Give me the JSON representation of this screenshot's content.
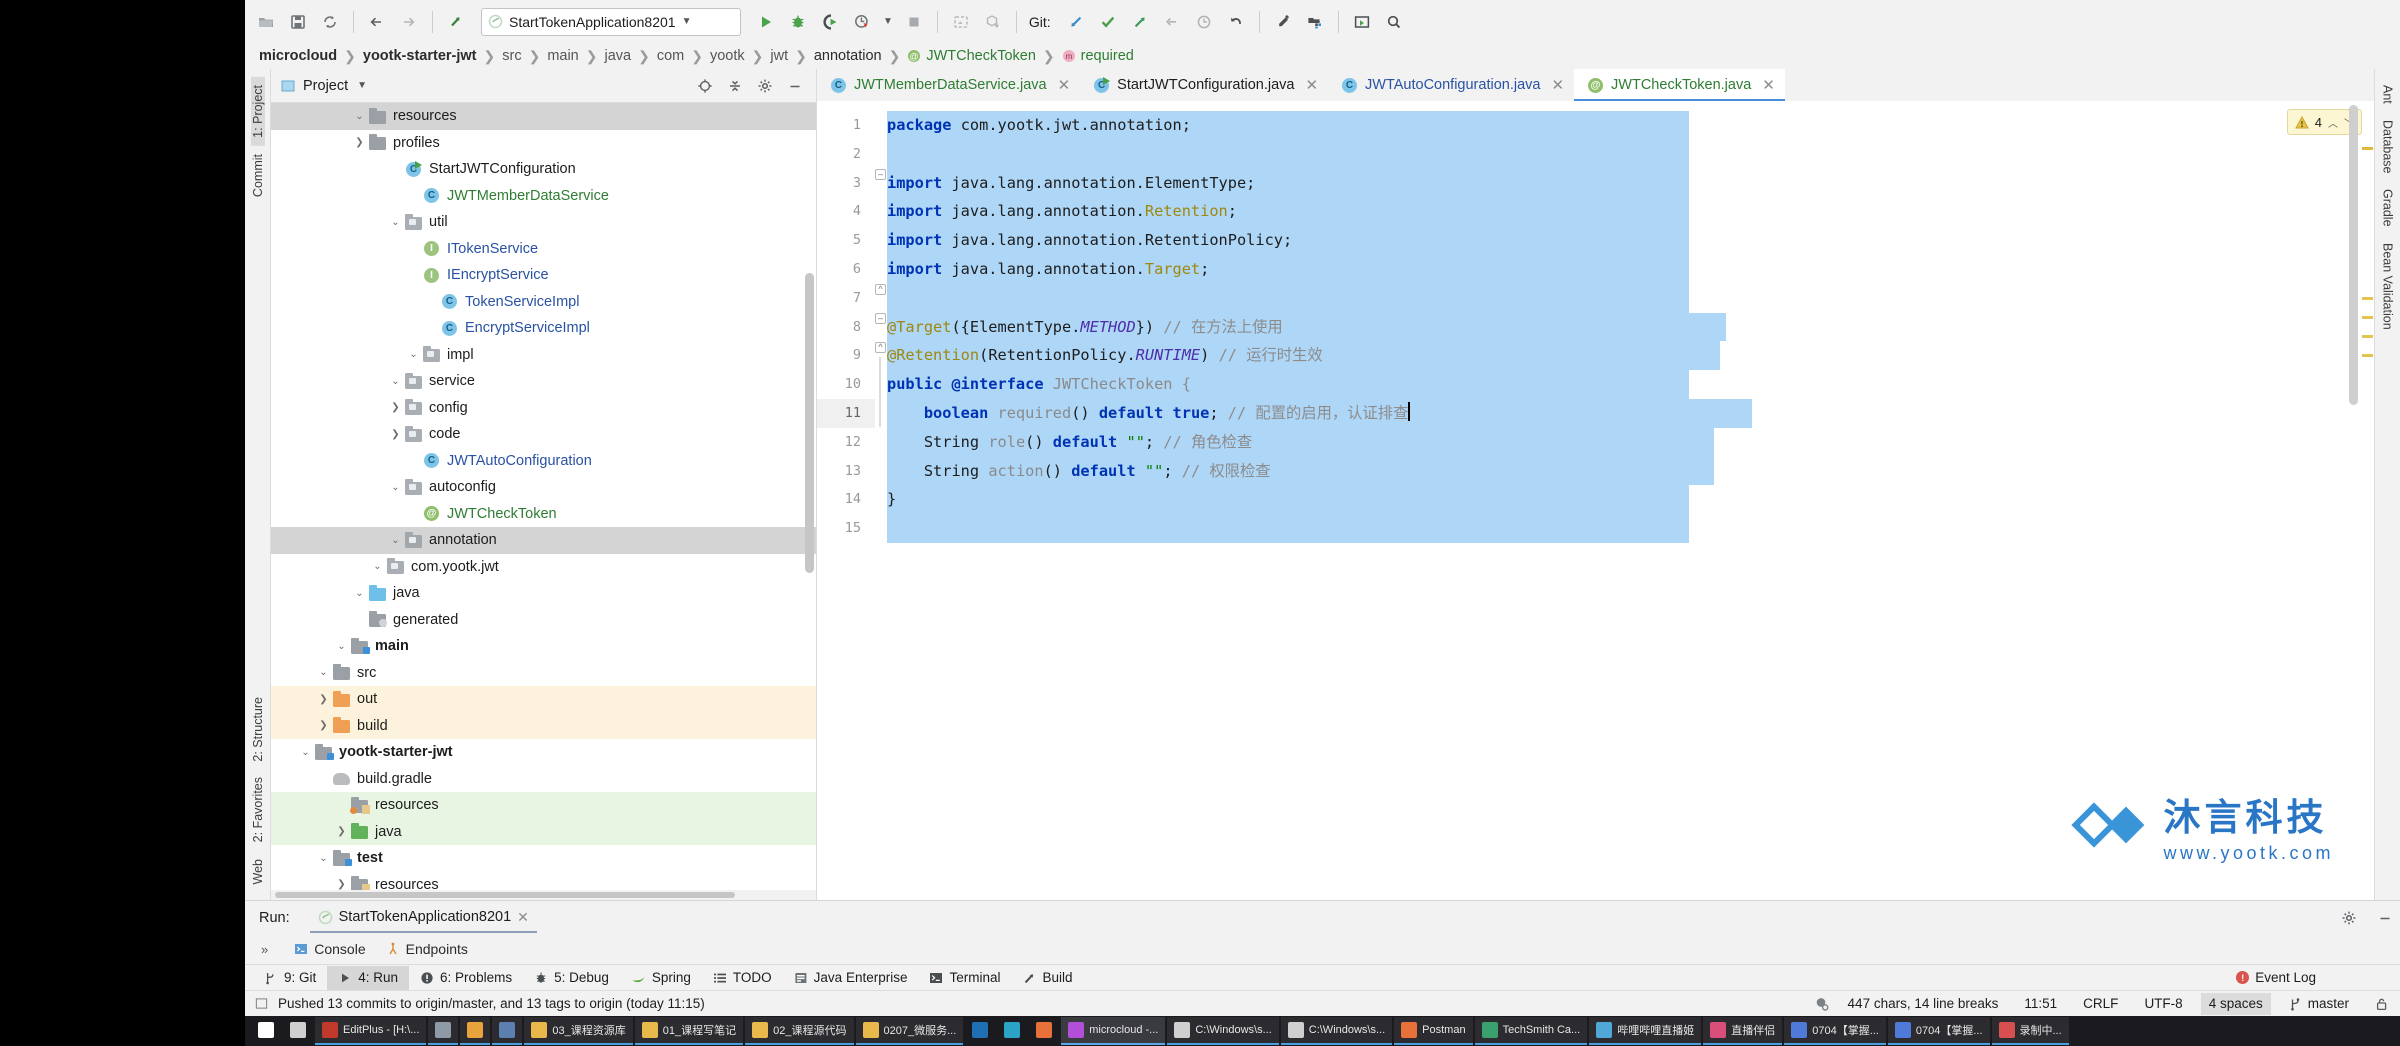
{
  "toolbar": {
    "buttons": [
      {
        "name": "open-folder",
        "label": "Open"
      },
      {
        "name": "save-all",
        "label": "Save All"
      },
      {
        "name": "sync",
        "label": "Synchronize"
      },
      {
        "name": "back",
        "label": "Back"
      },
      {
        "name": "forward",
        "label": "Forward"
      },
      {
        "name": "jump-to-source",
        "label": "Jump to Source"
      }
    ],
    "run_config": "StartTokenApplication8201",
    "run_label": "Run",
    "debug_label": "Debug",
    "run_coverage_label": "Run with Coverage",
    "profiler_label": "Profiler",
    "stop_label": "Stop",
    "git_label": "Git:",
    "git_actions": [
      "Update Project",
      "Commit",
      "Push",
      "Rollback",
      "History",
      "Revert"
    ],
    "settings_label": "Settings",
    "project-structure_label": "Project Structure",
    "search_label": "Search Everywhere"
  },
  "breadcrumb": [
    {
      "label": "microcloud",
      "style": "bold"
    },
    {
      "label": "yootk-starter-jwt",
      "style": "bold"
    },
    {
      "label": "src",
      "style": "dim"
    },
    {
      "label": "main",
      "style": "dim"
    },
    {
      "label": "java",
      "style": "dim"
    },
    {
      "label": "com",
      "style": "dim"
    },
    {
      "label": "yootk",
      "style": "dim"
    },
    {
      "label": "jwt",
      "style": "dim"
    },
    {
      "label": "annotation",
      "style": "plain"
    },
    {
      "label": "JWTCheckToken",
      "style": "green",
      "icon": "annotation-icon"
    },
    {
      "label": "required",
      "style": "green",
      "icon": "method-icon"
    }
  ],
  "left_strips": [
    {
      "label": "1: Project",
      "selected": true
    },
    {
      "label": "Commit",
      "selected": false
    },
    {
      "label": "2: Structure",
      "selected": false
    },
    {
      "label": "2: Favorites",
      "selected": false
    },
    {
      "label": "Web",
      "selected": false
    }
  ],
  "right_strips": [
    {
      "label": "Ant"
    },
    {
      "label": "Database"
    },
    {
      "label": "Gradle"
    },
    {
      "label": "Bean Validation"
    }
  ],
  "project_panel": {
    "title": "Project",
    "actions": [
      "locate-icon",
      "collapse-all-icon",
      "gear-icon",
      "minimize-icon"
    ],
    "tree": [
      {
        "indent": 3,
        "arrow": "right",
        "icon": "folder-grey",
        "label": "profiles",
        "row": "plain",
        "bold": false
      },
      {
        "indent": 3,
        "arrow": "right",
        "icon": "folder-resource",
        "label": "resources",
        "row": "plain",
        "bold": false
      },
      {
        "indent": 2,
        "arrow": "down",
        "icon": "folder-source-test",
        "label": "test",
        "row": "plain",
        "bold": true
      },
      {
        "indent": 3,
        "arrow": "right",
        "icon": "folder-green",
        "label": "java",
        "row": "green",
        "bold": false
      },
      {
        "indent": 3,
        "arrow": "none",
        "icon": "folder-test-resource",
        "label": "resources",
        "row": "green",
        "bold": false
      },
      {
        "indent": 2,
        "arrow": "none",
        "icon": "gradle-icon",
        "label": "build.gradle",
        "row": "plain",
        "bold": false
      },
      {
        "indent": 1,
        "arrow": "down",
        "icon": "folder-module",
        "label": "yootk-starter-jwt",
        "row": "plain",
        "bold": true
      },
      {
        "indent": 2,
        "arrow": "right",
        "icon": "folder-orange",
        "label": "build",
        "row": "orange",
        "bold": false
      },
      {
        "indent": 2,
        "arrow": "right",
        "icon": "folder-orange",
        "label": "out",
        "row": "orange",
        "bold": false
      },
      {
        "indent": 2,
        "arrow": "down",
        "icon": "folder-grey",
        "label": "src",
        "row": "plain",
        "bold": false
      },
      {
        "indent": 3,
        "arrow": "down",
        "icon": "folder-source-main",
        "label": "main",
        "row": "plain",
        "bold": true
      },
      {
        "indent": 4,
        "arrow": "none",
        "icon": "folder-generated",
        "label": "generated",
        "row": "plain",
        "bold": false
      },
      {
        "indent": 4,
        "arrow": "down",
        "icon": "folder-blue",
        "label": "java",
        "row": "plain",
        "bold": false
      },
      {
        "indent": 5,
        "arrow": "down",
        "icon": "package-icon",
        "label": "com.yootk.jwt",
        "row": "plain",
        "bold": false
      },
      {
        "indent": 6,
        "arrow": "down",
        "icon": "package-icon",
        "label": "annotation",
        "row": "selected",
        "bold": false
      },
      {
        "indent": 7,
        "arrow": "none",
        "icon": "annotation-icon",
        "label": "JWTCheckToken",
        "row": "plain",
        "bold": false,
        "color": "green"
      },
      {
        "indent": 6,
        "arrow": "down",
        "icon": "package-icon",
        "label": "autoconfig",
        "row": "plain",
        "bold": false
      },
      {
        "indent": 7,
        "arrow": "none",
        "icon": "class-icon",
        "label": "JWTAutoConfiguration",
        "row": "plain",
        "bold": false,
        "color": "blue"
      },
      {
        "indent": 6,
        "arrow": "right",
        "icon": "package-icon",
        "label": "code",
        "row": "plain",
        "bold": false
      },
      {
        "indent": 6,
        "arrow": "right",
        "icon": "package-icon",
        "label": "config",
        "row": "plain",
        "bold": false
      },
      {
        "indent": 6,
        "arrow": "down",
        "icon": "package-icon",
        "label": "service",
        "row": "plain",
        "bold": false
      },
      {
        "indent": 7,
        "arrow": "down",
        "icon": "package-icon",
        "label": "impl",
        "row": "plain",
        "bold": false
      },
      {
        "indent": 8,
        "arrow": "none",
        "icon": "class-icon",
        "label": "EncryptServiceImpl",
        "row": "plain",
        "bold": false,
        "color": "blue"
      },
      {
        "indent": 8,
        "arrow": "none",
        "icon": "class-icon",
        "label": "TokenServiceImpl",
        "row": "plain",
        "bold": false,
        "color": "blue"
      },
      {
        "indent": 7,
        "arrow": "none",
        "icon": "interface-icon",
        "label": "IEncryptService",
        "row": "plain",
        "bold": false,
        "color": "blue"
      },
      {
        "indent": 7,
        "arrow": "none",
        "icon": "interface-icon",
        "label": "ITokenService",
        "row": "plain",
        "bold": false,
        "color": "blue"
      },
      {
        "indent": 6,
        "arrow": "down",
        "icon": "package-icon",
        "label": "util",
        "row": "plain",
        "bold": false
      },
      {
        "indent": 7,
        "arrow": "none",
        "icon": "class-icon",
        "label": "JWTMemberDataService",
        "row": "plain",
        "bold": false,
        "color": "green"
      },
      {
        "indent": 6,
        "arrow": "none",
        "icon": "runnable-class-icon",
        "label": "StartJWTConfiguration",
        "row": "plain",
        "bold": false
      },
      {
        "indent": 4,
        "arrow": "right",
        "icon": "folder-grey",
        "label": "profiles",
        "row": "plain",
        "bold": false
      },
      {
        "indent": 4,
        "arrow": "down",
        "icon": "folder-grey",
        "label": "resources",
        "row": "selected",
        "bold": false
      }
    ]
  },
  "editor_tabs": [
    {
      "label": "JWTMemberDataService.java",
      "icon": "class-icon",
      "color": "green",
      "active": false
    },
    {
      "label": "StartJWTConfiguration.java",
      "icon": "runnable-class-icon",
      "color": "plain",
      "active": false
    },
    {
      "label": "JWTAutoConfiguration.java",
      "icon": "class-icon",
      "color": "blue",
      "active": false
    },
    {
      "label": "JWTCheckToken.java",
      "icon": "annotation-icon",
      "color": "green",
      "active": true
    }
  ],
  "editor": {
    "inspection_count": "4",
    "line_numbers": [
      "1",
      "2",
      "3",
      "4",
      "5",
      "6",
      "7",
      "8",
      "9",
      "10",
      "11",
      "12",
      "13",
      "14",
      "15"
    ],
    "current_line": 11,
    "lines": [
      [
        {
          "t": "package ",
          "c": "kw"
        },
        {
          "t": "com.yootk.jwt.annotation;",
          "c": ""
        }
      ],
      [],
      [
        {
          "t": "import ",
          "c": "kw"
        },
        {
          "t": "java.lang.annotation.ElementType;",
          "c": ""
        }
      ],
      [
        {
          "t": "import ",
          "c": "kw"
        },
        {
          "t": "java.lang.annotation.",
          "c": ""
        },
        {
          "t": "Retention",
          "c": "an"
        },
        {
          "t": ";",
          "c": ""
        }
      ],
      [
        {
          "t": "import ",
          "c": "kw"
        },
        {
          "t": "java.lang.annotation.RetentionPolicy;",
          "c": ""
        }
      ],
      [
        {
          "t": "import ",
          "c": "kw"
        },
        {
          "t": "java.lang.annotation.",
          "c": ""
        },
        {
          "t": "Target",
          "c": "an"
        },
        {
          "t": ";",
          "c": ""
        }
      ],
      [],
      [
        {
          "t": "@Target",
          "c": "an"
        },
        {
          "t": "({ElementType.",
          "c": ""
        },
        {
          "t": "METHOD",
          "c": "it"
        },
        {
          "t": "}) ",
          "c": ""
        },
        {
          "t": "// 在方法上使用",
          "c": "cm"
        }
      ],
      [
        {
          "t": "@Retention",
          "c": "an"
        },
        {
          "t": "(RetentionPolicy.",
          "c": ""
        },
        {
          "t": "RUNTIME",
          "c": "it"
        },
        {
          "t": ") ",
          "c": ""
        },
        {
          "t": "// 运行时生效",
          "c": "cm"
        }
      ],
      [
        {
          "t": "public ",
          "c": "kw"
        },
        {
          "t": "@interface ",
          "c": "kw"
        },
        {
          "t": "JWTCheckToken {",
          "c": "gy"
        }
      ],
      [
        {
          "t": "    boolean ",
          "c": "kw"
        },
        {
          "t": "required",
          "c": "gy"
        },
        {
          "t": "() ",
          "c": ""
        },
        {
          "t": "default true",
          "c": "kw"
        },
        {
          "t": "; ",
          "c": ""
        },
        {
          "t": "// 配置的启用，认证排查",
          "c": "cm"
        },
        {
          "t": "|",
          "c": "caret"
        }
      ],
      [
        {
          "t": "    String ",
          "c": ""
        },
        {
          "t": "role",
          "c": "gy"
        },
        {
          "t": "() ",
          "c": ""
        },
        {
          "t": "default ",
          "c": "kw"
        },
        {
          "t": "\"\"",
          "c": "st"
        },
        {
          "t": "; ",
          "c": ""
        },
        {
          "t": "// 角色检查",
          "c": "cm"
        }
      ],
      [
        {
          "t": "    String ",
          "c": ""
        },
        {
          "t": "action",
          "c": "gy"
        },
        {
          "t": "() ",
          "c": ""
        },
        {
          "t": "default ",
          "c": "kw"
        },
        {
          "t": "\"\"",
          "c": "st"
        },
        {
          "t": "; ",
          "c": ""
        },
        {
          "t": "// 权限检查",
          "c": "cm"
        }
      ],
      [
        {
          "t": "}",
          "c": ""
        }
      ],
      []
    ]
  },
  "watermark": {
    "cn": "沐言科技",
    "en": "www.yootk.com"
  },
  "run_window": {
    "label": "Run:",
    "tab": "StartTokenApplication8201",
    "subtabs": [
      "Console",
      "Endpoints"
    ],
    "gear": "settings-icon",
    "minimize": "minimize-icon"
  },
  "tool_buttons": [
    {
      "label": "9: Git",
      "mn": "9",
      "icon": "git-icon",
      "selected": false
    },
    {
      "label": "4: Run",
      "mn": "4",
      "icon": "run-icon",
      "selected": true
    },
    {
      "label": "6: Problems",
      "mn": "6",
      "icon": "problems-icon",
      "selected": false
    },
    {
      "label": "5: Debug",
      "mn": "5",
      "icon": "debug-icon",
      "selected": false
    },
    {
      "label": "Spring",
      "mn": "",
      "icon": "spring-icon",
      "selected": false
    },
    {
      "label": "TODO",
      "mn": "",
      "icon": "todo-icon",
      "selected": false
    },
    {
      "label": "Java Enterprise",
      "mn": "",
      "icon": "javaee-icon",
      "selected": false
    },
    {
      "label": "Terminal",
      "mn": "",
      "icon": "terminal-icon",
      "selected": false
    },
    {
      "label": "Build",
      "mn": "",
      "icon": "build-icon",
      "selected": false
    }
  ],
  "status_bar": {
    "message": "Pushed 13 commits to origin/master, and 13 tags to origin (today 11:15)",
    "chars": "447 chars, 14 line breaks",
    "position": "11:51",
    "line_sep": "CRLF",
    "encoding": "UTF-8",
    "indent": "4 spaces",
    "branch": "master",
    "event_log": "Event Log",
    "lock_icon": "lock-icon"
  },
  "taskbar": [
    {
      "label": "",
      "icon": "windows-start",
      "kind": "start"
    },
    {
      "label": "",
      "icon": "task-view",
      "kind": "plain"
    },
    {
      "label": "EditPlus - [H:\\...",
      "icon": "editplus-icon",
      "kind": "open"
    },
    {
      "label": "",
      "icon": "app-icon-grey",
      "kind": "open"
    },
    {
      "label": "",
      "icon": "chrome-icon",
      "kind": "open"
    },
    {
      "label": "",
      "icon": "explorer-icon",
      "kind": "open"
    },
    {
      "label": "03_课程资源库",
      "icon": "folder-icon",
      "kind": "open"
    },
    {
      "label": "01_课程写笔记",
      "icon": "folder-icon",
      "kind": "open"
    },
    {
      "label": "02_课程源代码",
      "icon": "folder-icon",
      "kind": "open"
    },
    {
      "label": "0207_微服务...",
      "icon": "folder-icon",
      "kind": "open"
    },
    {
      "label": "",
      "icon": "photoshop-icon",
      "kind": "plain"
    },
    {
      "label": "",
      "icon": "edge-icon",
      "kind": "plain"
    },
    {
      "label": "",
      "icon": "firefox-icon",
      "kind": "plain"
    },
    {
      "label": "microcloud -...",
      "icon": "intellij-icon",
      "kind": "active"
    },
    {
      "label": "C:\\Windows\\s...",
      "icon": "console-icon",
      "kind": "open"
    },
    {
      "label": "C:\\Windows\\s...",
      "icon": "console-icon",
      "kind": "open"
    },
    {
      "label": "Postman",
      "icon": "postman-icon",
      "kind": "open"
    },
    {
      "label": "TechSmith Ca...",
      "icon": "camtasia-icon",
      "kind": "open"
    },
    {
      "label": "哔哩哔哩直播姬",
      "icon": "bili-icon",
      "kind": "open"
    },
    {
      "label": "直播伴侣",
      "icon": "live-icon",
      "kind": "open"
    },
    {
      "label": "0704【掌握...",
      "icon": "video-icon",
      "kind": "open"
    },
    {
      "label": "0704【掌握...",
      "icon": "video-icon",
      "kind": "open"
    },
    {
      "label": "录制中...",
      "icon": "rec-icon",
      "kind": "open"
    }
  ]
}
